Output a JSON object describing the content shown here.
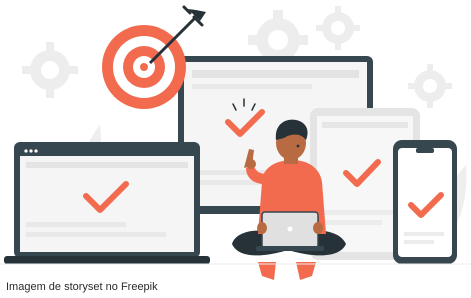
{
  "caption": "Imagem de storyset no Freepik",
  "colors": {
    "accent": "#f26b4f",
    "dark": "#263238",
    "device_frame": "#37474f",
    "screen": "#f5f5f5",
    "screen_lines": "#e3e3e3",
    "gear": "#ececec",
    "leaf": "#eeeeee",
    "skin": "#b86a43",
    "hair": "#263238"
  },
  "icons": [
    "target-icon",
    "arrow-icon",
    "checkmark-icon",
    "gear-icon",
    "laptop-icon",
    "tablet-icon",
    "phone-icon",
    "monitor-icon"
  ]
}
